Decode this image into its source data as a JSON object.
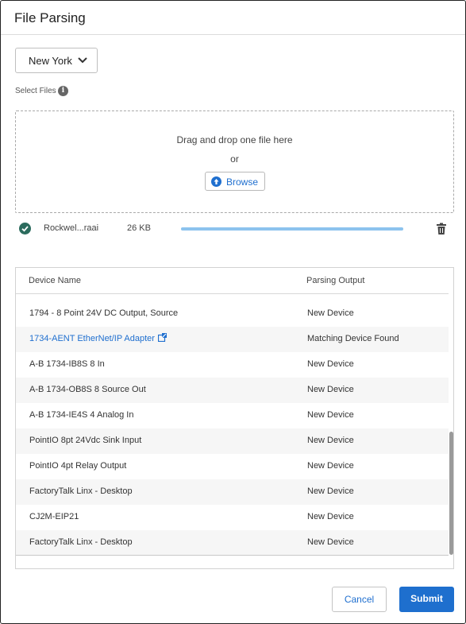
{
  "dialog": {
    "title": "File Parsing"
  },
  "location_select": {
    "value": "New York",
    "icon": "chevron-down-icon"
  },
  "select_files": {
    "label": "Select Files",
    "info_icon": "info-icon",
    "info_glyph": "i"
  },
  "dropzone": {
    "instruction": "Drag and drop one file here",
    "or": "or",
    "browse_label": "Browse",
    "browse_icon": "upload-icon"
  },
  "uploaded_file": {
    "status_icon": "check-circle-icon",
    "name": "Rockwel...raai",
    "size": "26 KB",
    "progress": 1.0,
    "delete_icon": "trash-icon"
  },
  "table": {
    "columns": [
      "Device Name",
      "Parsing Output"
    ],
    "rows": [
      {
        "name": "1794 - 8 Point 24V DC Output, Source",
        "output": "New Device",
        "link": false
      },
      {
        "name": "1734-AENT EtherNet/IP Adapter",
        "output": "Matching Device Found",
        "link": true
      },
      {
        "name": "A-B 1734-IB8S 8 In",
        "output": "New Device",
        "link": false
      },
      {
        "name": "A-B 1734-OB8S 8 Source Out",
        "output": "New Device",
        "link": false
      },
      {
        "name": "A-B 1734-IE4S 4 Analog In",
        "output": "New Device",
        "link": false
      },
      {
        "name": "PointIO 8pt 24Vdc Sink Input",
        "output": "New Device",
        "link": false
      },
      {
        "name": "PointIO 4pt Relay Output",
        "output": "New Device",
        "link": false
      },
      {
        "name": "FactoryTalk Linx - Desktop",
        "output": "New Device",
        "link": false
      },
      {
        "name": "CJ2M-EIP21",
        "output": "New Device",
        "link": false
      },
      {
        "name": "FactoryTalk Linx - Desktop",
        "output": "New Device",
        "link": false
      }
    ]
  },
  "footer": {
    "cancel_label": "Cancel",
    "submit_label": "Submit"
  },
  "colors": {
    "accent": "#1e6fce",
    "link": "#1f6fcf",
    "success": "#2b6b5d",
    "progress": "#8cc3ee"
  }
}
